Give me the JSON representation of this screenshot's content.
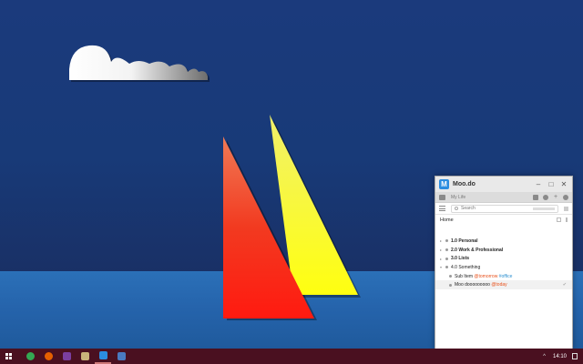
{
  "app": {
    "logo": "M",
    "title": "Moo.do",
    "window_controls": [
      "minimize",
      "maximize",
      "close"
    ],
    "breadcrumb": "My Life",
    "search_placeholder": "Search",
    "home_label": "Home",
    "tree": [
      {
        "label": "1.0 Personal",
        "bold": true,
        "child": false
      },
      {
        "label": "2.0 Work & Professional",
        "bold": true,
        "child": false
      },
      {
        "label": "3.0 Lists",
        "bold": true,
        "child": false
      },
      {
        "label": "4.0 Something",
        "bold": false,
        "child": false,
        "expanded": true
      },
      {
        "label": "Sub Item",
        "date_tag": "@tomorrow",
        "hash_tag": "#office",
        "child": true
      },
      {
        "label": "Moo dooooooooo",
        "date_tag": "@today",
        "child": true,
        "highlighted": true
      }
    ]
  },
  "taskbar": {
    "apps": [
      {
        "icon": "chrome-icon",
        "color": "#34a853"
      },
      {
        "icon": "firefox-icon",
        "color": "#e66000"
      },
      {
        "icon": "onenote-icon",
        "color": "#7b3fa0"
      },
      {
        "icon": "explorer-icon",
        "color": "#c9b37a"
      },
      {
        "icon": "moodo-icon",
        "color": "#2b8de0"
      },
      {
        "icon": "notepad-icon",
        "color": "#4a7ac0"
      }
    ],
    "clock": "14:10"
  },
  "colors": {
    "accent": "#2b8de0",
    "date_tag": "#e8501a",
    "hash_tag": "#2a8fd0",
    "taskbar": "#4a1020"
  }
}
